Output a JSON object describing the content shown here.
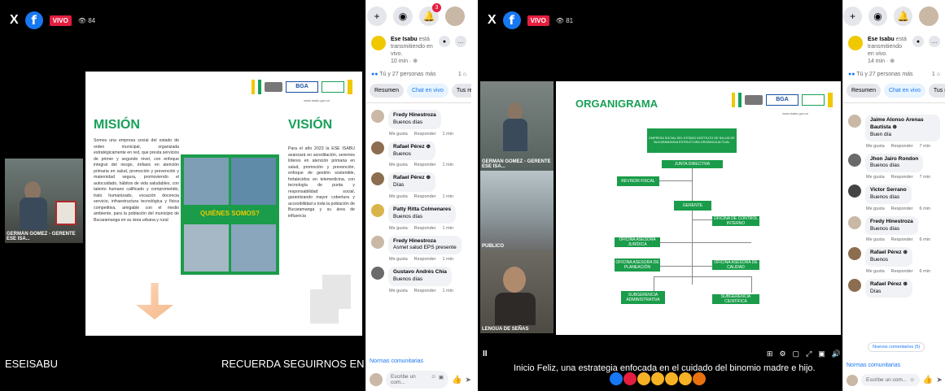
{
  "left": {
    "live_label": "VIVO",
    "viewers": "84",
    "slide": {
      "mision_title": "MISIÓN",
      "mision_text": "Somos una empresa social del estado de orden municipal, organizada estratégicamente en red, que presta servicios de primer y segundo nivel, con enfoque integral del riesgo, énfasis en atención primaria en salud, promoción y prevención y maternidad segura, promoviendo el autocuidado, hábitos de vida saludables, con talento humano calificado y comprometido, trato humanizado, vocación docencia servicio, infraestructura tecnológica y física competitiva, amigable con el medio ambiente, para la población del municipio de Bucaramanga en su área urbana y rural",
      "vision_title": "VISIÓN",
      "vision_text": "Para el año 2023 la ESE ISABU avanzará en acreditación, seremos líderes en atención primaria en salud, promoción y prevención, enfoque de gestión sostenible, fortalecidos en telemedicina, con tecnología de punta y responsabilidad social, garantizando mayor cobertura y accesibilidad a toda la población de Bucaramanga y su área de influencia",
      "banner": "QUIÉNES SOMOS?",
      "url": "www.isabu.gov.co"
    },
    "thumb_label": "GERMAN GOMEZ - GERENTE ESE ISA...",
    "ticker_left": "ESEISABU",
    "ticker_right": "RECUERDA SEGUIRNOS EN NUSTRAS RE"
  },
  "left_sidebar": {
    "host_name": "Ese Isabu",
    "host_status": "está transmitiendo en vivo.",
    "host_time": "10 min · ⊕",
    "reactions": "Tú y 27 personas más",
    "shares": "1 ⌂",
    "tabs": [
      "Resumen",
      "Chat en vivo",
      "Tus respuest"
    ],
    "comments": [
      {
        "name": "Fredy Hinestroza",
        "text": "Buenos días",
        "time": "1 min"
      },
      {
        "name": "Rafael Pérez ⊕",
        "text": "Buenos",
        "time": "1 min"
      },
      {
        "name": "Rafael Pérez ⊕",
        "text": "Días",
        "time": "1 min"
      },
      {
        "name": "Patty Ritta Colmenares",
        "text": "Buenos días",
        "time": "1 min"
      },
      {
        "name": "Fredy Hinestroza",
        "text": "Asmet salud EPS presente",
        "time": "1 min"
      },
      {
        "name": "Gustavo Andrés Chia",
        "text": "Buenos días",
        "time": "1 min"
      }
    ],
    "like_label": "Me gusta",
    "reply_label": "Responder",
    "community": "Normas comunitarias",
    "write_placeholder": "Escribe un com..."
  },
  "right": {
    "live_label": "VIVO",
    "viewers": "81",
    "slide": {
      "title": "ORGANIGRAMA",
      "url": "www.isabu.gov.co",
      "boxes": {
        "top": "EMPRESA SOCIAL DEL ESTADO INSTITUTO DE SALUD DE BUCARAMANGA ESTRUCTURA ORGÁNICA ACTUAL",
        "junta": "JUNTA DIRECTIVA",
        "revisor": "REVISOR FISCAL",
        "gerente": "GERENTE",
        "control": "OFICINA DE CONTROL INTERNO",
        "juridica": "OFICINA ASESORA JURÍDICA",
        "planeacion": "OFICINA ASESORA DE PLANEACIÓN",
        "calidad": "OFICINA ASESORA DE CALIDAD",
        "admin": "SUBGERENCIA ADMINISTRATIVA",
        "cientifica": "SUBGERENCIA CIENTÍFICA"
      }
    },
    "thumb_labels": [
      "GERMAN GOMEZ - GERENTE ESE ISA...",
      "PUBLICO",
      "LENGUA DE SEÑAS"
    ],
    "ticker": "Inicio Feliz, una estrategia enfocada en el cuidado del binomio madre e hijo."
  },
  "right_sidebar": {
    "host_name": "Ese Isabu",
    "host_status": "está transmitiendo en vivo.",
    "host_time": "14 min · ⊕",
    "reactions": "Tú y 27 personas más",
    "shares": "1 ⌂",
    "tabs": [
      "Resumen",
      "Chat en vivo",
      "Tus respuest"
    ],
    "comments": [
      {
        "name": "Jaime Alonso Arenas Bautista ⊕",
        "text": "Buen día",
        "time": "7 min"
      },
      {
        "name": "Jhon Jairo Rondon",
        "text": "Buenos días",
        "time": "7 min"
      },
      {
        "name": "Victor Serrano",
        "text": "Buenos días",
        "time": "6 min"
      },
      {
        "name": "Fredy Hinestroza",
        "text": "Buenos días",
        "time": "6 min"
      },
      {
        "name": "Rafael Pérez ⊕",
        "text": "Buenos",
        "time": "6 min"
      },
      {
        "name": "Rafael Pérez ⊕",
        "text": "Días",
        "time": "6 min"
      }
    ],
    "new_comment": "Nuevos comentarios (5)",
    "like_label": "Me gusta",
    "reply_label": "Responder",
    "community": "Normas comunitarias",
    "write_placeholder": "Escribe un com..."
  }
}
